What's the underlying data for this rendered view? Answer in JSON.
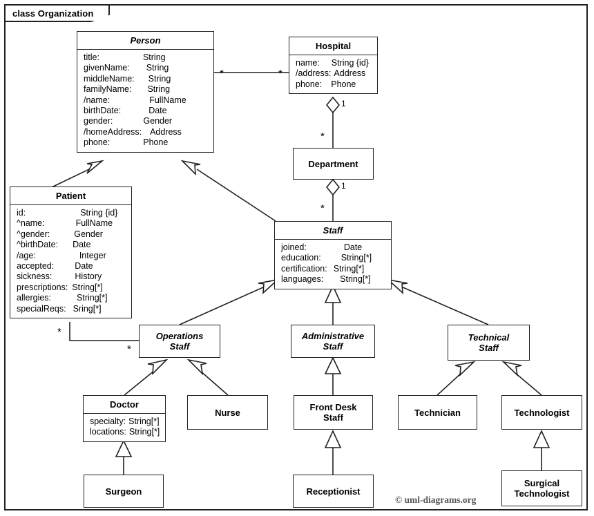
{
  "frame": {
    "tab_label": "class Organization"
  },
  "copyright": "© uml-diagrams.org",
  "classes": {
    "person": {
      "name": "Person",
      "attributes": [
        {
          "name": "title:",
          "type": "String"
        },
        {
          "name": "givenName:",
          "type": "String"
        },
        {
          "name": "middleName:",
          "type": "String"
        },
        {
          "name": "familyName:",
          "type": "String"
        },
        {
          "name": "/name:",
          "type": "FullName"
        },
        {
          "name": "birthDate:",
          "type": "Date"
        },
        {
          "name": "gender:",
          "type": "Gender"
        },
        {
          "name": "/homeAddress:",
          "type": "Address"
        },
        {
          "name": "phone:",
          "type": "Phone"
        }
      ]
    },
    "hospital": {
      "name": "Hospital",
      "attributes": [
        {
          "name": "name:",
          "type": "String {id}"
        },
        {
          "name": "/address:",
          "type": "Address"
        },
        {
          "name": "phone:",
          "type": "Phone"
        }
      ]
    },
    "department": {
      "name": "Department",
      "attributes": []
    },
    "patient": {
      "name": "Patient",
      "attributes": [
        {
          "name": "id:",
          "type": "String {id}"
        },
        {
          "name": "^name:",
          "type": "FullName"
        },
        {
          "name": "^gender:",
          "type": "Gender"
        },
        {
          "name": "^birthDate:",
          "type": "Date"
        },
        {
          "name": "/age:",
          "type": "Integer"
        },
        {
          "name": "accepted:",
          "type": "Date"
        },
        {
          "name": "sickness:",
          "type": "History"
        },
        {
          "name": "prescriptions:",
          "type": "String[*]"
        },
        {
          "name": "allergies:",
          "type": "String[*]"
        },
        {
          "name": "specialReqs:",
          "type": "Sring[*]"
        }
      ]
    },
    "staff": {
      "name": "Staff",
      "attributes": [
        {
          "name": "joined:",
          "type": "Date"
        },
        {
          "name": "education:",
          "type": "String[*]"
        },
        {
          "name": "certification:",
          "type": "String[*]"
        },
        {
          "name": "languages:",
          "type": "String[*]"
        }
      ]
    },
    "operations_staff": {
      "name": "Operations\nStaff",
      "attributes": []
    },
    "administrative_staff": {
      "name": "Administrative\nStaff",
      "attributes": []
    },
    "technical_staff": {
      "name": "Technical\nStaff",
      "attributes": []
    },
    "doctor": {
      "name": "Doctor",
      "attributes": [
        {
          "name": "specialty:",
          "type": "String[*]"
        },
        {
          "name": "locations:",
          "type": "String[*]"
        }
      ]
    },
    "nurse": {
      "name": "Nurse",
      "attributes": []
    },
    "front_desk_staff": {
      "name": "Front Desk\nStaff",
      "attributes": []
    },
    "technician": {
      "name": "Technician",
      "attributes": []
    },
    "technologist": {
      "name": "Technologist",
      "attributes": []
    },
    "surgeon": {
      "name": "Surgeon",
      "attributes": []
    },
    "receptionist": {
      "name": "Receptionist",
      "attributes": []
    },
    "surgical_technologist": {
      "name": "Surgical\nTechnologist",
      "attributes": []
    }
  },
  "multiplicities": {
    "person_hospital_person_end": "*",
    "person_hospital_hospital_end": "*",
    "hospital_department_hospital_end": "1",
    "hospital_department_department_end": "*",
    "department_staff_department_end": "1",
    "department_staff_staff_end": "*",
    "patient_operations_patient_end": "*",
    "patient_operations_staff_end": "*"
  },
  "colors": {
    "stroke": "#231f20",
    "background": "#ffffff",
    "text": "#000000",
    "copyright_text": "#58595b"
  }
}
